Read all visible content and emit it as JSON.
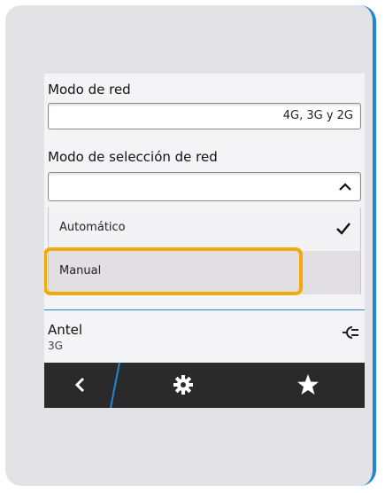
{
  "network_mode": {
    "label": "Modo de red",
    "value": "4G, 3G y 2G"
  },
  "selection_mode": {
    "label": "Modo de selección de red",
    "options": [
      {
        "label": "Automático",
        "selected": true
      },
      {
        "label": "Manual",
        "selected": false
      }
    ]
  },
  "carrier": {
    "name": "Antel",
    "tech": "3G"
  },
  "bottom_bar": {
    "buttons": [
      "back-icon",
      "settings-icon",
      "star-icon"
    ]
  },
  "colors": {
    "accent": "#1e88d6",
    "highlight": "#f2a90a",
    "bar": "#2a2a2b"
  }
}
